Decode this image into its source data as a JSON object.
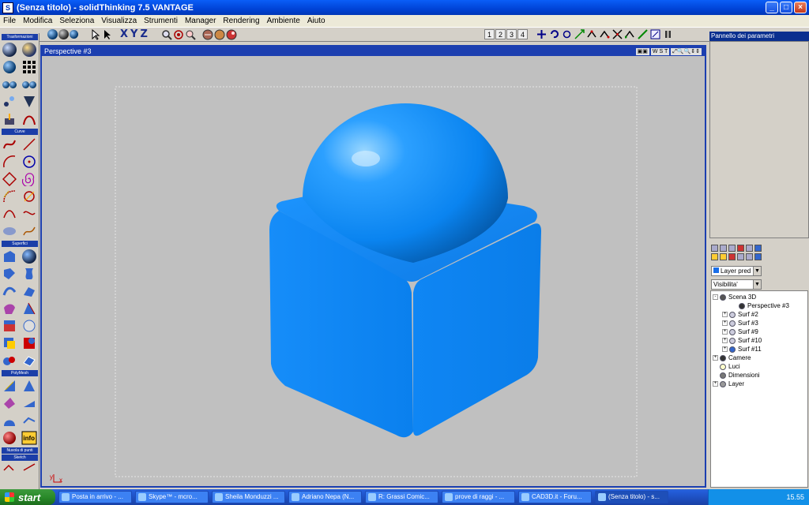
{
  "window": {
    "title": "(Senza titolo) - solidThinking 7.5  VANTAGE",
    "minimize": "_",
    "maximize": "□",
    "close": "×"
  },
  "menu": [
    "File",
    "Modifica",
    "Seleziona",
    "Visualizza",
    "Strumenti",
    "Manager",
    "Rendering",
    "Ambiente",
    "Aiuto"
  ],
  "toolbar": {
    "xyz": [
      "X",
      "Y",
      "Z"
    ],
    "views": [
      "1",
      "2",
      "3",
      "4"
    ]
  },
  "left_sections": [
    "Trasformazioni",
    "Curve",
    "Superfici",
    "PolyMesh",
    "Nuvola di punti",
    "Sketch"
  ],
  "left_info": "info",
  "viewport": {
    "title": "Perspective #3",
    "buttons": [
      "W S T"
    ],
    "axis_x": "x",
    "axis_y": "y"
  },
  "right_panel": {
    "param_title": "Pannello dei parametri",
    "layer_dropdown": "Layer pred",
    "visibility_dropdown": "Visibilita'",
    "tree": [
      {
        "label": "Scena 3D",
        "level": 0,
        "pm": "-",
        "icon": "scene"
      },
      {
        "label": "Perspective #3",
        "level": 2,
        "pm": "",
        "icon": "camera"
      },
      {
        "label": "Surf #2",
        "level": 1,
        "pm": "+",
        "icon": "surf"
      },
      {
        "label": "Surf #3",
        "level": 1,
        "pm": "+",
        "icon": "surf"
      },
      {
        "label": "Surf #9",
        "level": 1,
        "pm": "+",
        "icon": "surf"
      },
      {
        "label": "Surf #10",
        "level": 1,
        "pm": "+",
        "icon": "surf"
      },
      {
        "label": "Surf #11",
        "level": 1,
        "pm": "+",
        "icon": "cube"
      },
      {
        "label": "Camere",
        "level": 0,
        "pm": "+",
        "icon": "camera"
      },
      {
        "label": "Luci",
        "level": 0,
        "pm": "",
        "icon": "light"
      },
      {
        "label": "Dimensioni",
        "level": 0,
        "pm": "",
        "icon": "dim"
      },
      {
        "label": "Layer",
        "level": 0,
        "pm": "+",
        "icon": "layer"
      }
    ]
  },
  "taskbar": {
    "start": "start",
    "tasks": [
      "Posta in arrivo - ...",
      "Skype™ - mcro...",
      "Sheila Monduzzi ...",
      "Adriano Nepa (N...",
      "R: Grassi Comic...",
      "prove di raggi - ...",
      "CAD3D.it - Foru...",
      "(Senza titolo) - s..."
    ],
    "lang": "IT",
    "clock": "15.55"
  }
}
